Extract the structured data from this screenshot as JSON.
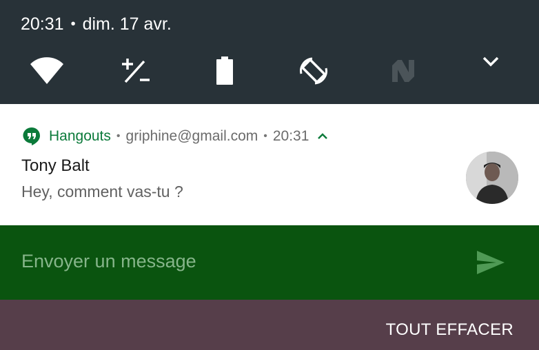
{
  "status": {
    "time": "20:31",
    "separator": "•",
    "date": "dim. 17 avr."
  },
  "quick_settings": {
    "tiles": [
      {
        "icon": "wifi-icon"
      },
      {
        "icon": "data-saver-icon"
      },
      {
        "icon": "battery-icon"
      },
      {
        "icon": "auto-rotate-icon"
      },
      {
        "icon": "nfc-icon"
      }
    ],
    "expand_icon": "chevron-down-icon"
  },
  "notification": {
    "app_icon": "hangouts-icon",
    "app_name": "Hangouts",
    "separator": "•",
    "account": "griphine@gmail.com",
    "time": "20:31",
    "title": "Tony Balt",
    "text": "Hey, comment vas-tu ?",
    "avatar": "avatar-icon"
  },
  "reply": {
    "placeholder": "Envoyer un message",
    "send_icon": "send-icon"
  },
  "actions": {
    "clear_all": "TOUT EFFACER"
  },
  "colors": {
    "header_bg": "#283238",
    "card_bg": "#ffffff",
    "brand_green": "#0b7a3a",
    "reply_bg": "#0a540f",
    "shade_bg": "#563e4a"
  }
}
